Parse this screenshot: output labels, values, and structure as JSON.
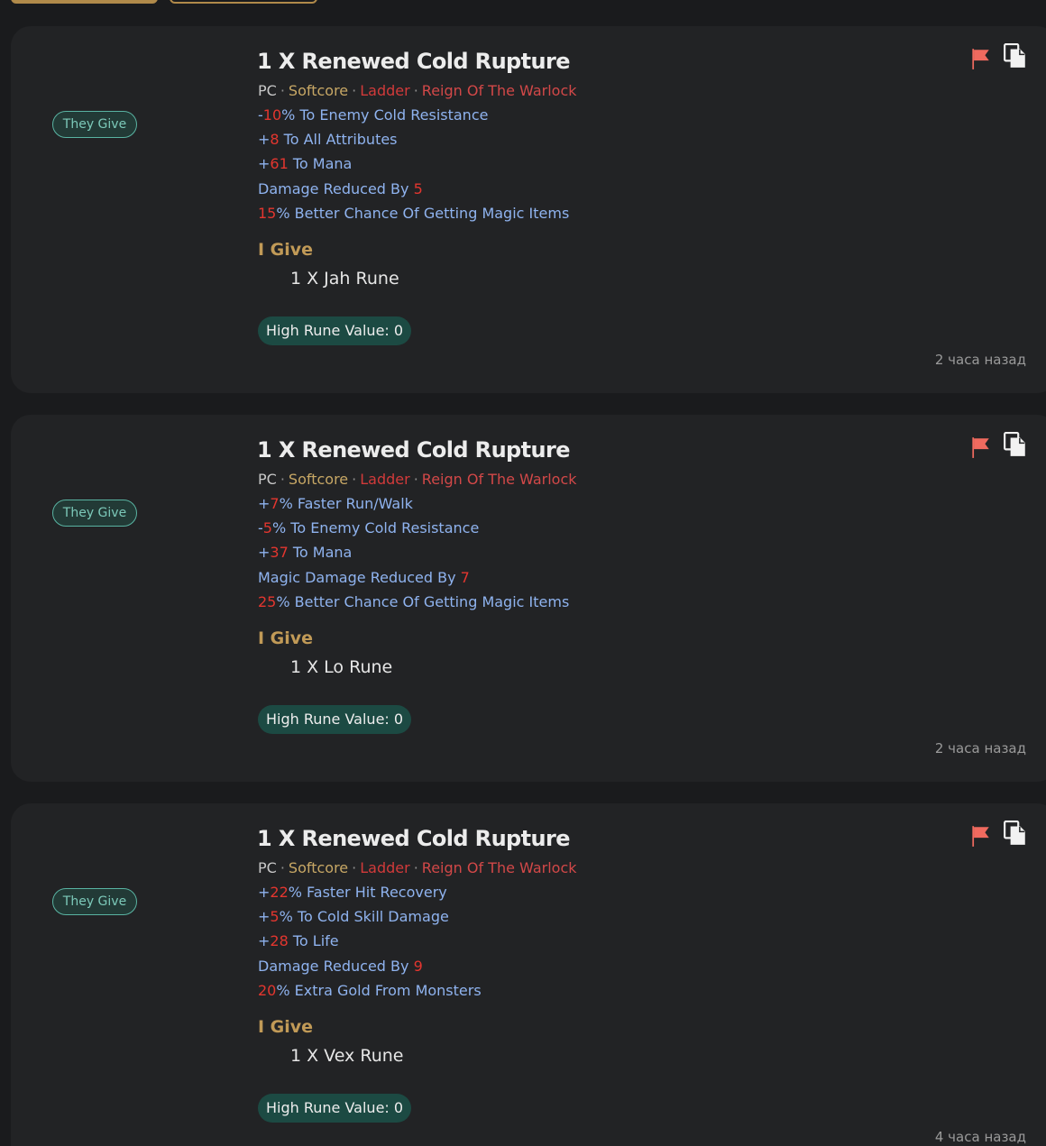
{
  "listings": [
    {
      "tag": "They Give",
      "title": "1 X Renewed Cold Rupture",
      "meta": {
        "platform": "PC",
        "mode": "Softcore",
        "ladder": "Ladder",
        "season": "Reign Of The Warlock"
      },
      "stats": [
        {
          "prefix": "-",
          "num": "10",
          "suffix": "% To Enemy Cold Resistance"
        },
        {
          "prefix": "+",
          "num": "8",
          "suffix": " To All Attributes"
        },
        {
          "prefix": "+",
          "num": "61",
          "suffix": " To Mana"
        },
        {
          "prefix": "Damage Reduced By ",
          "num": "5",
          "suffix": ""
        },
        {
          "prefix": "",
          "num": "15",
          "suffix": "% Better Chance Of Getting Magic Items"
        }
      ],
      "i_give_label": "I Give",
      "give_item": "1 X Jah Rune",
      "rune_value": "High Rune Value: 0",
      "time": "2 часа назад"
    },
    {
      "tag": "They Give",
      "title": "1 X Renewed Cold Rupture",
      "meta": {
        "platform": "PC",
        "mode": "Softcore",
        "ladder": "Ladder",
        "season": "Reign Of The Warlock"
      },
      "stats": [
        {
          "prefix": "+",
          "num": "7",
          "suffix": "% Faster Run/Walk"
        },
        {
          "prefix": "-",
          "num": "5",
          "suffix": "% To Enemy Cold Resistance"
        },
        {
          "prefix": "+",
          "num": "37",
          "suffix": " To Mana"
        },
        {
          "prefix": "Magic Damage Reduced By ",
          "num": "7",
          "suffix": ""
        },
        {
          "prefix": "",
          "num": "25",
          "suffix": "% Better Chance Of Getting Magic Items"
        }
      ],
      "i_give_label": "I Give",
      "give_item": "1 X Lo Rune",
      "rune_value": "High Rune Value: 0",
      "time": "2 часа назад"
    },
    {
      "tag": "They Give",
      "title": "1 X Renewed Cold Rupture",
      "meta": {
        "platform": "PC",
        "mode": "Softcore",
        "ladder": "Ladder",
        "season": "Reign Of The Warlock"
      },
      "stats": [
        {
          "prefix": "+",
          "num": "22",
          "suffix": "% Faster Hit Recovery"
        },
        {
          "prefix": "+",
          "num": "5",
          "suffix": "% To Cold Skill Damage"
        },
        {
          "prefix": "+",
          "num": "28",
          "suffix": " To Life"
        },
        {
          "prefix": "Damage Reduced By ",
          "num": "9",
          "suffix": ""
        },
        {
          "prefix": "",
          "num": "20",
          "suffix": "% Extra Gold From Monsters"
        }
      ],
      "i_give_label": "I Give",
      "give_item": "1 X Vex Rune",
      "rune_value": "High Rune Value: 0",
      "time": "4 часа назад"
    }
  ],
  "icons": {
    "flag": "report-flag-icon",
    "copy": "copy-icon"
  },
  "colors": {
    "background": "#1a1b1d",
    "card": "#222325",
    "accent_gold": "#c19a57",
    "stat_blue": "#8fb3ef",
    "stat_number_red": "#e3362f",
    "flag_red": "#f06a5f",
    "rune_badge_bg": "#1c4a43",
    "tag_teal": "#59b3a2"
  }
}
